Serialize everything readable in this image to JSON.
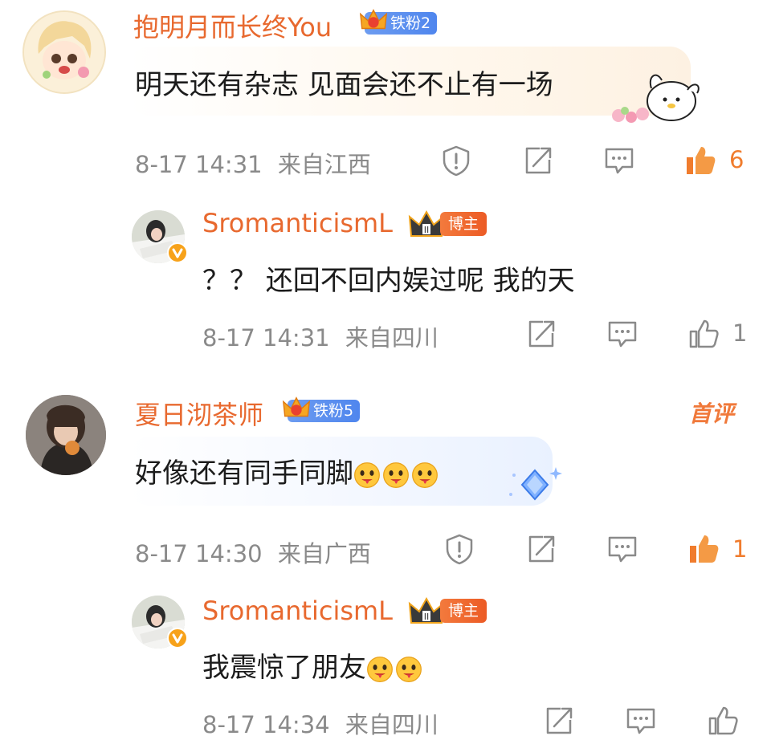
{
  "comments": [
    {
      "user": "抱明月而长终You",
      "fan_badge": "铁粉2",
      "text": "明天还有杂志 见面会还不止有一场",
      "time": "8-17 14:31",
      "location": "来自江西",
      "likes": "6",
      "liked": true,
      "reply": {
        "user": "SromanticismL",
        "host_badge": "博主",
        "text": "？？ 还回不回内娱过呢 我的天",
        "time": "8-17 14:31",
        "location": "来自四川",
        "likes": "1"
      }
    },
    {
      "user": "夏日沏茶师",
      "fan_badge": "铁粉5",
      "first_tag": "首评",
      "text": "好像还有同手同脚",
      "time": "8-17 14:30",
      "location": "来自广西",
      "likes": "1",
      "liked": true,
      "reply": {
        "user": "SromanticismL",
        "host_badge": "博主",
        "text": "我震惊了朋友",
        "time": "8-17 14:34",
        "location": "来自四川",
        "likes": ""
      }
    }
  ],
  "colors": {
    "username": "#e8692f",
    "meta": "#8a8a8a",
    "like_active": "#f07c2d",
    "fan_badge": "#5b8def",
    "host_badge": "#ec5b25"
  },
  "icons": [
    "report-icon",
    "share-icon",
    "comment-icon",
    "like-icon"
  ]
}
